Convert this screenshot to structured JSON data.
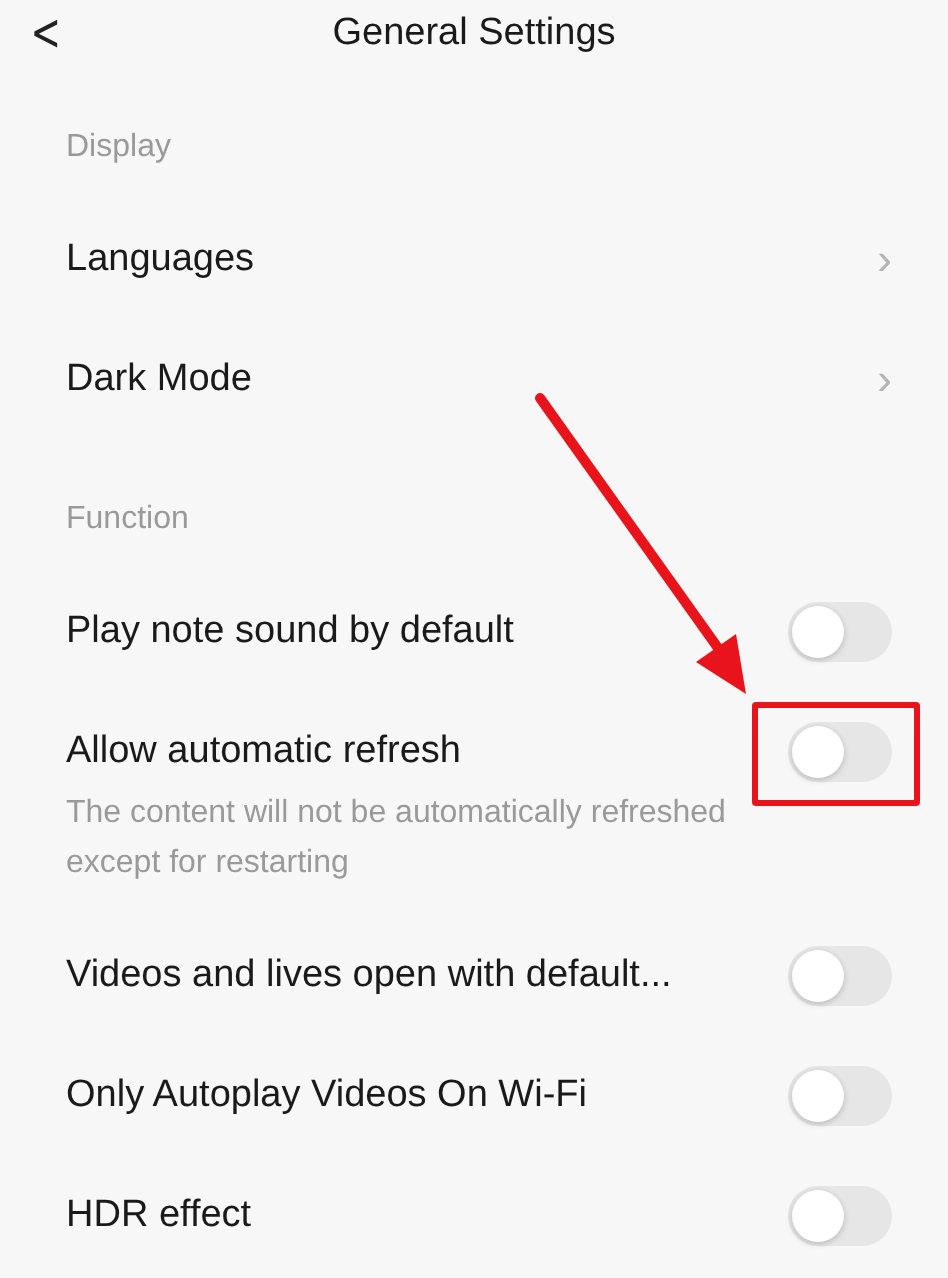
{
  "header": {
    "back": "<",
    "title": "General Settings"
  },
  "sections": [
    {
      "title": "Display",
      "items": [
        {
          "kind": "link",
          "label": "Languages",
          "chevron": "›"
        },
        {
          "kind": "link",
          "label": "Dark Mode",
          "chevron": "›"
        }
      ]
    },
    {
      "title": "Function",
      "items": [
        {
          "kind": "toggle",
          "label": "Play note sound by default",
          "on": false,
          "highlighted": false
        },
        {
          "kind": "toggle",
          "label": "Allow automatic refresh",
          "on": false,
          "highlighted": true,
          "description": "The content will not be automatically refreshed except for restarting"
        },
        {
          "kind": "toggle",
          "label": "Videos and lives open with default...",
          "on": false,
          "highlighted": false
        },
        {
          "kind": "toggle",
          "label": "Only Autoplay Videos On Wi-Fi",
          "on": false,
          "highlighted": false
        },
        {
          "kind": "toggle",
          "label": "HDR effect",
          "on": false,
          "highlighted": false
        }
      ]
    }
  ]
}
